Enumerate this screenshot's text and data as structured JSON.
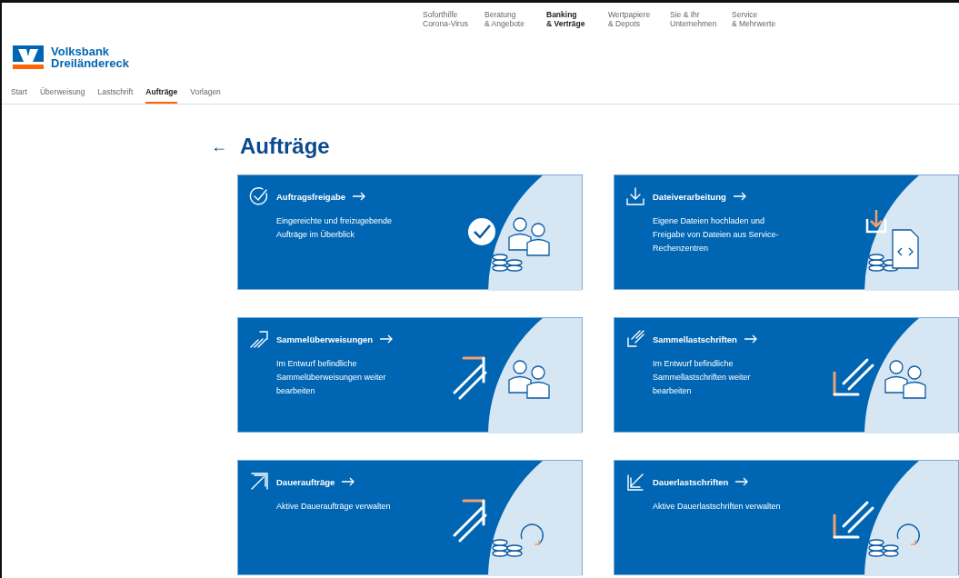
{
  "top_nav": [
    {
      "line1": "Soforthilfe",
      "line2": "Corona-Virus",
      "selected": false
    },
    {
      "line1": "Beratung",
      "line2": "& Angebote",
      "selected": false
    },
    {
      "line1": "Banking",
      "line2": "& Verträge",
      "selected": true
    },
    {
      "line1": "Wertpapiere",
      "line2": "& Depots",
      "selected": false
    },
    {
      "line1": "Sie & Ihr",
      "line2": "Unternehmen",
      "selected": false
    },
    {
      "line1": "Service",
      "line2": "& Mehrwerte",
      "selected": false
    }
  ],
  "logo": {
    "line1": "Volksbank",
    "line2": "Dreiländereck"
  },
  "sub_nav": [
    {
      "label": "Start",
      "selected": false
    },
    {
      "label": "Überweisung",
      "selected": false
    },
    {
      "label": "Lastschrift",
      "selected": false
    },
    {
      "label": "Aufträge",
      "selected": true
    },
    {
      "label": "Vorlagen",
      "selected": false
    }
  ],
  "back": "←",
  "page_title": "Aufträge",
  "cards": [
    {
      "kind": "release",
      "title": "Auftragsfreigabe",
      "description": "Eingereichte und freizugebende Aufträge im Überblick"
    },
    {
      "kind": "files",
      "title": "Dateiverarbeitung",
      "description": "Eigene Dateien hochladen und Freigabe von Dateien aus Service-Rechenzentren"
    },
    {
      "kind": "bulk_transfer",
      "title": "Sammelüberweisungen",
      "description": "Im Entwurf befindliche Sammelüberweisungen weiter bearbeiten"
    },
    {
      "kind": "bulk_debit",
      "title": "Sammellastschriften",
      "description": "Im Entwurf befindliche Sammellastschriften weiter bearbeiten"
    },
    {
      "kind": "standing_order",
      "title": "Daueraufträge",
      "description": "Aktive Daueraufträge verwalten"
    },
    {
      "kind": "standing_debit",
      "title": "Dauerlastschriften",
      "description": "Aktive Dauerlastschriften verwalten"
    }
  ]
}
